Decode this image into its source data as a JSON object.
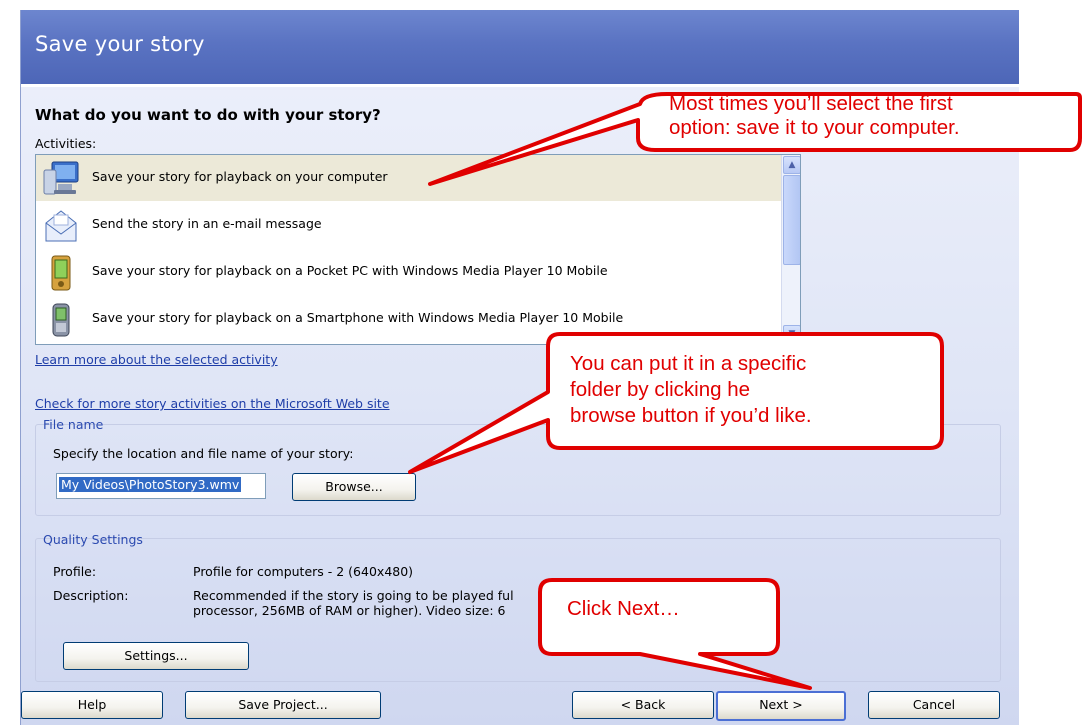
{
  "window": {
    "title": "Save your story"
  },
  "main": {
    "question": "What do you want to do with your story?",
    "activities_label": "Activities:",
    "activities": [
      {
        "label": "Save your story for playback on your computer",
        "icon": "computer-icon",
        "selected": true
      },
      {
        "label": "Send the story in an e-mail message",
        "icon": "envelope-icon",
        "selected": false
      },
      {
        "label": "Save your story for playback on a Pocket PC with Windows Media Player 10 Mobile",
        "icon": "pocket-pc-icon",
        "selected": false
      },
      {
        "label": "Save your story for playback on a Smartphone with Windows Media Player 10 Mobile",
        "icon": "smartphone-icon",
        "selected": false
      }
    ],
    "learn_more_link": "Learn more about the selected activity",
    "check_more_link": "Check for more story activities on the Microsoft Web site"
  },
  "file_name": {
    "group_title": "File name",
    "prompt": "Specify the location and file name of your story:",
    "value": "My Videos\\PhotoStory3.wmv",
    "browse_label": "Browse..."
  },
  "quality": {
    "group_title": "Quality Settings",
    "profile_label": "Profile:",
    "profile_value": "Profile for computers - 2 (640x480)",
    "description_label": "Description:",
    "description_line1": "Recommended if the story is going to be played ful",
    "description_line2": "processor, 256MB of RAM or higher). Video size: 6",
    "settings_label": "Settings..."
  },
  "footer": {
    "help_label": "Help",
    "save_project_label": "Save Project...",
    "back_label": "< Back",
    "next_label": "Next >",
    "cancel_label": "Cancel"
  },
  "callouts": {
    "first_line1": "Most times you’ll select the first",
    "first_line2": "option: save it to your computer.",
    "second_line1": "You can put it in a specific",
    "second_line2": "folder by clicking he",
    "second_line3": "browse button if you’d like.",
    "third": "Click Next…"
  },
  "colors": {
    "header": "#5a73c2",
    "callout_red": "#e00000",
    "link_blue": "#1f3ea8",
    "selection_highlight": "#316ac5"
  }
}
